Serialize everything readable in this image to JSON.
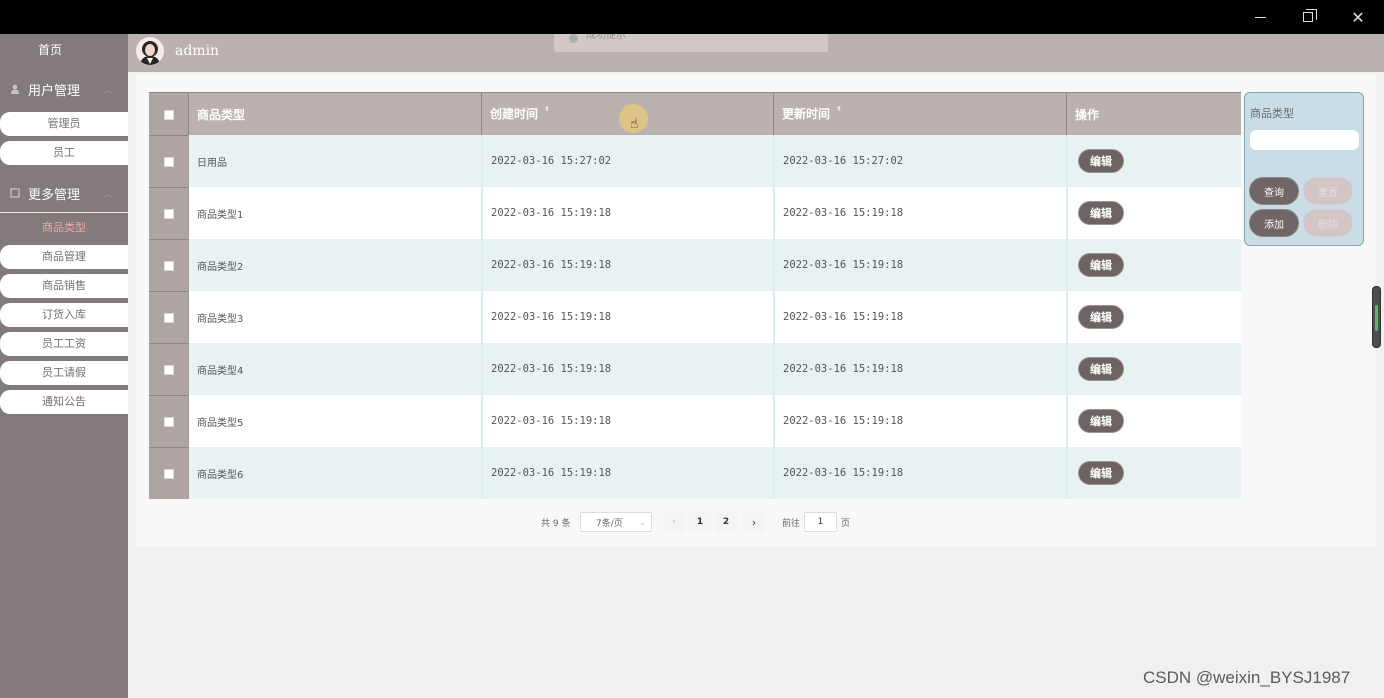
{
  "window": {
    "controls": [
      "minimize-icon",
      "restore-icon",
      "close-icon"
    ]
  },
  "sidebar": {
    "home": "首页",
    "groups": [
      {
        "title": "用户管理",
        "icon": "user-icon",
        "items": [
          "管理员",
          "员工"
        ]
      },
      {
        "title": "更多管理",
        "icon": "document-icon",
        "items": [
          "商品类型",
          "商品管理",
          "商品销售",
          "订货入库",
          "员工工资",
          "员工请假",
          "通知公告"
        ]
      }
    ],
    "active_item": "商品类型",
    "active_color": "#f2a6a6"
  },
  "header": {
    "username": "admin",
    "toast": "成功提示"
  },
  "table": {
    "columns": [
      "商品类型",
      "创建时间",
      "更新时间",
      "操作"
    ],
    "sortable_columns": [
      "创建时间",
      "更新时间"
    ],
    "rows": [
      {
        "type": "日用品",
        "created": "2022-03-16 15:27:02",
        "updated": "2022-03-16 15:27:02",
        "action": "编辑"
      },
      {
        "type": "商品类型1",
        "created": "2022-03-16 15:19:18",
        "updated": "2022-03-16 15:19:18",
        "action": "编辑"
      },
      {
        "type": "商品类型2",
        "created": "2022-03-16 15:19:18",
        "updated": "2022-03-16 15:19:18",
        "action": "编辑"
      },
      {
        "type": "商品类型3",
        "created": "2022-03-16 15:19:18",
        "updated": "2022-03-16 15:19:18",
        "action": "编辑"
      },
      {
        "type": "商品类型4",
        "created": "2022-03-16 15:19:18",
        "updated": "2022-03-16 15:19:18",
        "action": "编辑"
      },
      {
        "type": "商品类型5",
        "created": "2022-03-16 15:19:18",
        "updated": "2022-03-16 15:19:18",
        "action": "编辑"
      },
      {
        "type": "商品类型6",
        "created": "2022-03-16 15:19:18",
        "updated": "2022-03-16 15:19:18",
        "action": "编辑"
      }
    ]
  },
  "pagination": {
    "total": "共 9 条",
    "page_size": "7条/页",
    "pages": [
      "1",
      "2"
    ],
    "goto_label": "前往",
    "goto_value": "1",
    "page_unit": "页"
  },
  "search": {
    "label": "商品类型",
    "value": "",
    "buttons": {
      "query": "查询",
      "reset": "重置",
      "add": "添加",
      "delete": "删除"
    }
  },
  "colors": {
    "sidebar_bg": "#837b7b",
    "header_bg": "#bbb2b0",
    "row_alt_bg": "#e8f2f3",
    "button_dark": "#6c6362",
    "search_panel_bg": "#c9dde6"
  },
  "watermark": "CSDN @weixin_BYSJ1987"
}
